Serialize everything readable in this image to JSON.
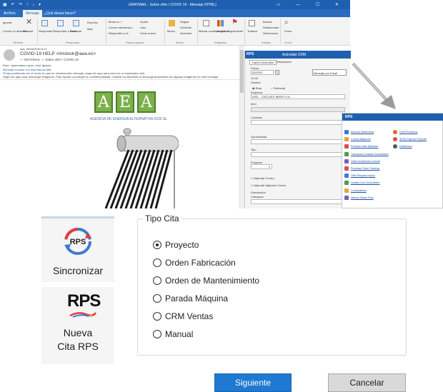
{
  "outlook": {
    "title": "GRAYMAIL - Sobre ofire / COVID 19 - Mensaje (HTML)",
    "quick_access": "▣ ↶ ↷ ↑ ↓ ▾",
    "window_controls": "▭ — ☐ ✕",
    "tabs": [
      "Archivo",
      "Mensaje",
      "¿Qué desea hacer?"
    ],
    "ribbon": {
      "ignorar": "Ignorar",
      "correo_deseado": "Correo no deseado",
      "eliminar": "Eliminar",
      "responder": "Responder",
      "responder_todos": "Responder a todos",
      "reenviar": "Reenviar",
      "reunion": "Reunión",
      "mas": "Más",
      "mover_a": "Mover a: ?",
      "correo_electronico": "Correo electrónico...",
      "responder_eliminar": "Responder y el...",
      "al_jefe": "Al jefe",
      "listo": "Listo",
      "crear_nuevo": "Crear nuevo",
      "mover": "Mover",
      "reglas": "Reglas",
      "onenote": "OneNote",
      "acciones": "Acciones",
      "marcar_no_leido": "Marcar como no leído",
      "categorizar": "Categorizar",
      "seguimiento": "Seguimiento",
      "traducir": "Traducir",
      "buscar": "Buscar",
      "relacionado": "Relacionado",
      "seleccionar": "Seleccionar",
      "zoom": "Zoom",
      "groups": [
        "Eliminar",
        "Responder",
        "Pasos rápidos",
        "Mover",
        "Etiquetas",
        "Edición",
        "Zoom"
      ]
    },
    "message": {
      "date": "mar. 05/05/2020 8:27",
      "subject": "COVID-19 HELP <imstock@aea.es>",
      "subline": "— GRAYMAIL — Sobre ofire / COVID 19",
      "to": "Para: Jayermales Lazos; José Ignacio",
      "importance": "Mensaje enviado con importancia Alta.",
      "info1": "Si hay problemas con el modo en que se muestra este mensaje, haga clic aquí para verlo en un explorador web.",
      "info2": "Haga clic aquí para descargar imágenes. Para ayudar a proteger su confidencialidad, Outlook ha impedido la descarga automática de algunas imágenes en este mensaje.",
      "logo_letters": [
        "A",
        "E",
        "A"
      ],
      "logo_caption": "AGENCIA DE ENERGIA ALTERNATIVA 2020 SL"
    },
    "crm": {
      "header": "Actividad CRM",
      "tabs": [
        "Datos Generales",
        "Descripción"
      ],
      "fecha_label": "Fecha",
      "fecha_value": "05/2020",
      "hora_value": "12:45",
      "gestion": "Gestión",
      "real": "Real",
      "potencial": "Potencial",
      "empresa_label": "Empresa",
      "empresa_value": "0001 - CASCAES IBERO S.A.",
      "item_label": "Item",
      "contacto_label": "Contacto",
      "oportunidad_label": "Oportunidad",
      "tipo_label": "Tipo",
      "progreso_label": "Progreso",
      "progreso_value": "0",
      "adjuntar_correo": "Adjuntar Correo",
      "adjuntar_adjuntos": "Adjuntar Adjuntos Correo",
      "descripcion_label": "Descripción",
      "categoria_label": "Categoría",
      "mensaje_por_email": "Mensaje por Email"
    },
    "rps_menu": {
      "header": "RPS",
      "left_items": [
        "Account Statements",
        "Current Balances",
        "Previous Date Balances",
        "Transports Contract Consultation",
        "Order Incidences Consult",
        "Purchase Order Tracking",
        "Offer Request Inquiry",
        "Quality Cost Consultation",
        "Consultations",
        "Various Status Flow"
      ],
      "right_items": [
        "Draft Provisions",
        "SEPA Payment Reports",
        "Dashboard"
      ]
    }
  },
  "sidebar": {
    "sincronizar_label": "Sincronizar",
    "rps_logo_text": "RPS",
    "nueva_cita_label_1": "Nueva",
    "nueva_cita_label_2": "Cita RPS"
  },
  "dialog": {
    "group_title": "Tipo Cita",
    "options": [
      {
        "label": "Proyecto",
        "checked": true
      },
      {
        "label": "Orden Fabricación",
        "checked": false
      },
      {
        "label": "Orden de Mantenimiento",
        "checked": false
      },
      {
        "label": "Parada Máquina",
        "checked": false
      },
      {
        "label": "CRM Ventas",
        "checked": false
      },
      {
        "label": "Manual",
        "checked": false
      }
    ],
    "next_button": "Siguiente",
    "cancel_button": "Cancelar"
  },
  "colors": {
    "outlook_blue": "#1f5fb0",
    "primary_button": "#1f78d1",
    "logo_green": "#7bb04a",
    "link_blue": "#1b4fa0"
  }
}
